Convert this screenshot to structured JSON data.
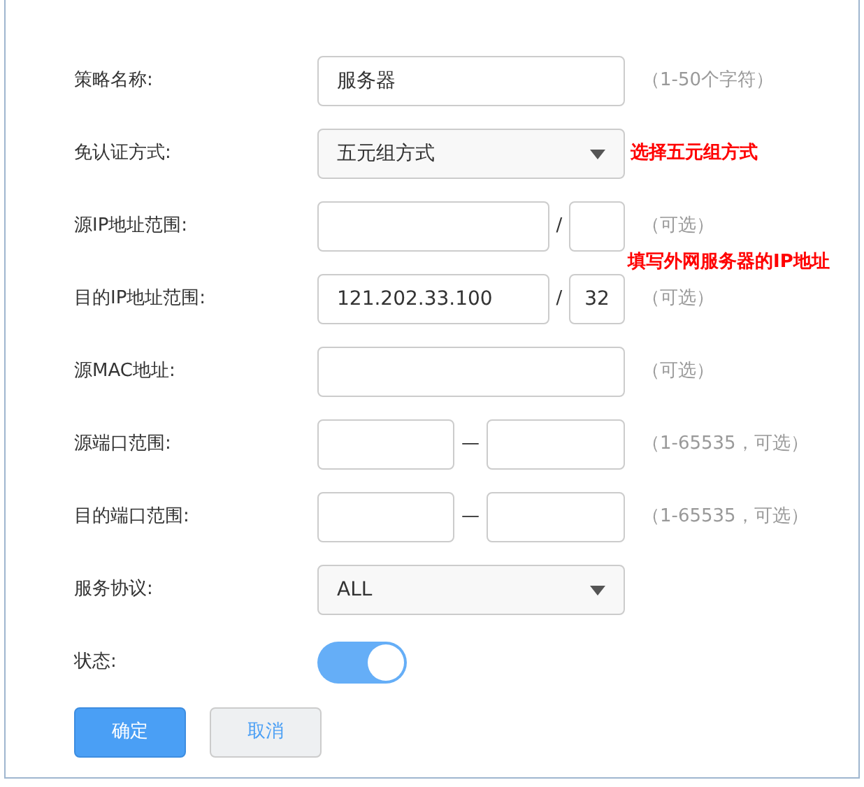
{
  "fields": [
    {
      "kind": "text",
      "label": "策略名称:",
      "value": "服务器",
      "hint": "（1-50个字符）"
    },
    {
      "kind": "select",
      "label": "免认证方式:",
      "value": "五元组方式",
      "note": "选择五元组方式"
    },
    {
      "kind": "ip",
      "label": "源IP地址范围:",
      "separator": "/",
      "hint": "（可选）"
    },
    {
      "kind": "ip",
      "label": "目的IP地址范围:",
      "value": "121.202.33.100",
      "separator": "/",
      "value_2": "32",
      "hint": "（可选）",
      "note": "填写外网服务器的IP地址"
    },
    {
      "kind": "text",
      "label": "源MAC地址:",
      "hint": "（可选）"
    },
    {
      "kind": "range",
      "label": "源端口范围:",
      "separator": "—",
      "hint": "（1-65535，可选）"
    },
    {
      "kind": "range",
      "label": "目的端口范围:",
      "separator": "—",
      "hint": "（1-65535，可选）"
    },
    {
      "kind": "select",
      "label": "服务协议:",
      "value": "ALL"
    },
    {
      "kind": "toggle",
      "label": "状态:",
      "on": true
    }
  ],
  "buttons": [
    {
      "label": "确定",
      "kind": "primary"
    },
    {
      "label": "取消",
      "kind": "secondary"
    }
  ]
}
